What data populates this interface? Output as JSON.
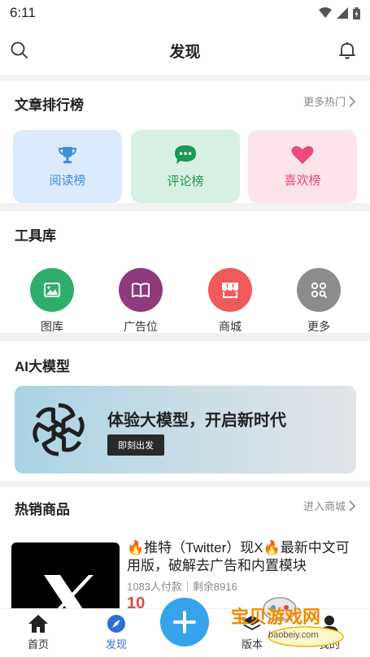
{
  "status_bar": {
    "time": "6:11"
  },
  "header": {
    "title": "发现"
  },
  "ranking": {
    "title": "文章排行榜",
    "more": "更多热门",
    "cards": [
      {
        "label": "阅读榜",
        "icon": "trophy-icon",
        "bg": "#dbeafd",
        "color": "#3d8fe0"
      },
      {
        "label": "评论榜",
        "icon": "chat-bubble-icon",
        "bg": "#d8f0e4",
        "color": "#1a9a55"
      },
      {
        "label": "喜欢榜",
        "icon": "heart-icon",
        "bg": "#fde3ea",
        "color": "#ec4b78"
      }
    ]
  },
  "tools": {
    "title": "工具库",
    "items": [
      {
        "label": "图库",
        "icon": "image-icon",
        "color": "#2fae6a"
      },
      {
        "label": "广告位",
        "icon": "book-icon",
        "color": "#8e3a7c"
      },
      {
        "label": "商城",
        "icon": "store-icon",
        "color": "#f05a5a"
      },
      {
        "label": "更多",
        "icon": "grid-search-icon",
        "color": "#8c8c8c"
      }
    ]
  },
  "ai": {
    "title": "AI大模型",
    "slogan": "体验大模型，开启新时代",
    "button": "即刻出发"
  },
  "hot_products": {
    "title": "热销商品",
    "more": "进入商城",
    "items": [
      {
        "title": "🔥推特（Twitter）现X🔥最新中文可用版，破解去广告和内置模块",
        "meta": "1083人付款｜剩余8916",
        "price": "10"
      }
    ]
  },
  "tabbar": {
    "items": [
      {
        "label": "首页",
        "icon": "home-icon"
      },
      {
        "label": "发现",
        "icon": "compass-icon",
        "active": true
      },
      {
        "label": "版本",
        "icon": "layers-icon"
      },
      {
        "label": "我的",
        "icon": "user-icon"
      }
    ]
  },
  "watermark": {
    "text": "宝贝游戏网",
    "sub": "baobeiy.com"
  },
  "colors": {
    "accent": "#2f6fd6",
    "fab": "#36a3ec",
    "price": "#e04a3f"
  }
}
